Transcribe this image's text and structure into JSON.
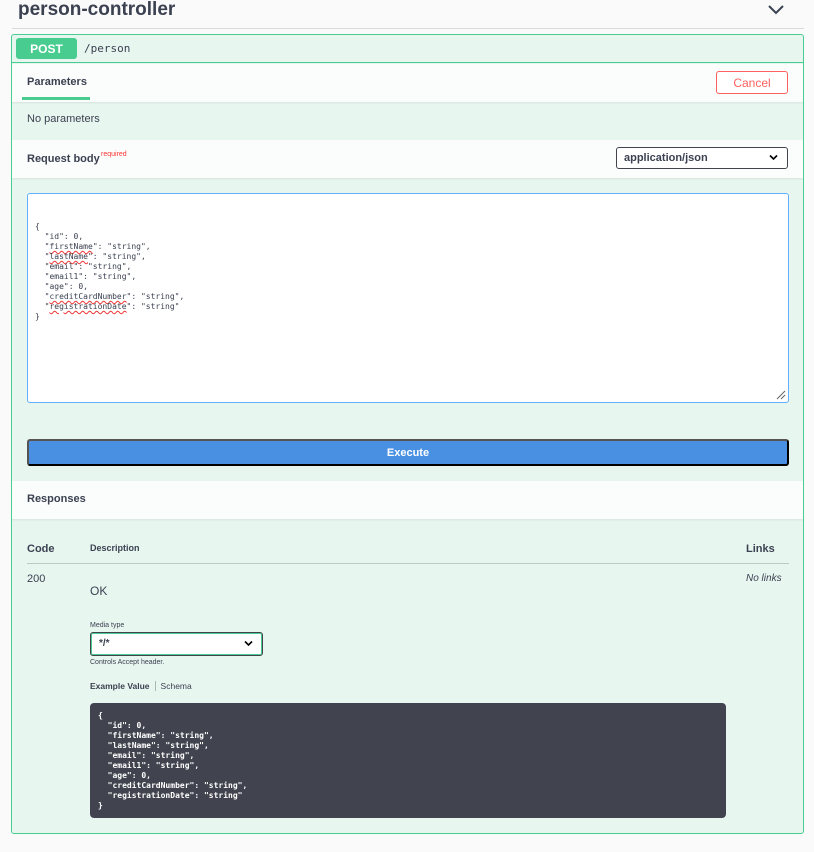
{
  "tag": {
    "title": "person-controller"
  },
  "operation": {
    "method": "POST",
    "path": "/person",
    "parameters_tab": "Parameters",
    "cancel_label": "Cancel",
    "no_parameters": "No parameters",
    "request_body_label": "Request body",
    "required_label": "required",
    "content_type": "application/json",
    "request_body_lines": [
      "{",
      "  \"id\": 0,",
      "  \"firstName\": \"string\",",
      "  \"lastName\": \"string\",",
      "  \"email\": \"string\",",
      "  \"email1\": \"string\",",
      "  \"age\": 0,",
      "  \"creditCardNumber\": \"string\",",
      "  \"registrationDate\": \"string\"",
      "}"
    ],
    "execute_label": "Execute"
  },
  "responses": {
    "label": "Responses",
    "columns": {
      "code": "Code",
      "description": "Description",
      "links": "Links"
    },
    "rows": [
      {
        "code": "200",
        "description": "OK",
        "links": "No links",
        "media_type_label": "Media type",
        "media_type": "*/*",
        "controls_accept": "Controls Accept header.",
        "tab_example": "Example Value",
        "tab_schema": "Schema",
        "example_lines": [
          "{",
          "  \"id\": 0,",
          "  \"firstName\": \"string\",",
          "  \"lastName\": \"string\",",
          "  \"email\": \"string\",",
          "  \"email1\": \"string\",",
          "  \"age\": 0,",
          "  \"creditCardNumber\": \"string\",",
          "  \"registrationDate\": \"string\"",
          "}"
        ]
      }
    ]
  },
  "colors": {
    "post": "#49cc90",
    "execute": "#4990e2",
    "cancel": "#ff6060",
    "code_bg": "#41444e"
  },
  "icons": {
    "collapse": "chevron-down-icon",
    "select": "chevron-down-icon",
    "resize": "resize-grip-icon"
  }
}
